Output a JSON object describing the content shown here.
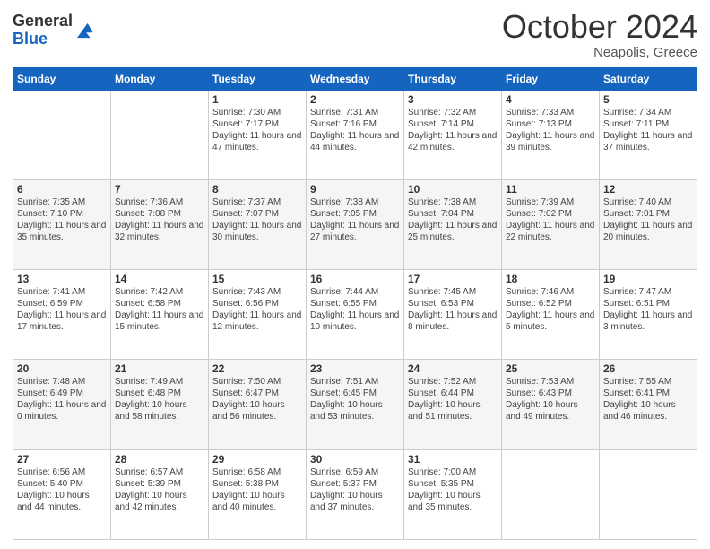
{
  "header": {
    "logo_general": "General",
    "logo_blue": "Blue",
    "month": "October 2024",
    "location": "Neapolis, Greece"
  },
  "weekdays": [
    "Sunday",
    "Monday",
    "Tuesday",
    "Wednesday",
    "Thursday",
    "Friday",
    "Saturday"
  ],
  "weeks": [
    [
      {
        "day": "",
        "sunrise": "",
        "sunset": "",
        "daylight": ""
      },
      {
        "day": "",
        "sunrise": "",
        "sunset": "",
        "daylight": ""
      },
      {
        "day": "1",
        "sunrise": "Sunrise: 7:30 AM",
        "sunset": "Sunset: 7:17 PM",
        "daylight": "Daylight: 11 hours and 47 minutes."
      },
      {
        "day": "2",
        "sunrise": "Sunrise: 7:31 AM",
        "sunset": "Sunset: 7:16 PM",
        "daylight": "Daylight: 11 hours and 44 minutes."
      },
      {
        "day": "3",
        "sunrise": "Sunrise: 7:32 AM",
        "sunset": "Sunset: 7:14 PM",
        "daylight": "Daylight: 11 hours and 42 minutes."
      },
      {
        "day": "4",
        "sunrise": "Sunrise: 7:33 AM",
        "sunset": "Sunset: 7:13 PM",
        "daylight": "Daylight: 11 hours and 39 minutes."
      },
      {
        "day": "5",
        "sunrise": "Sunrise: 7:34 AM",
        "sunset": "Sunset: 7:11 PM",
        "daylight": "Daylight: 11 hours and 37 minutes."
      }
    ],
    [
      {
        "day": "6",
        "sunrise": "Sunrise: 7:35 AM",
        "sunset": "Sunset: 7:10 PM",
        "daylight": "Daylight: 11 hours and 35 minutes."
      },
      {
        "day": "7",
        "sunrise": "Sunrise: 7:36 AM",
        "sunset": "Sunset: 7:08 PM",
        "daylight": "Daylight: 11 hours and 32 minutes."
      },
      {
        "day": "8",
        "sunrise": "Sunrise: 7:37 AM",
        "sunset": "Sunset: 7:07 PM",
        "daylight": "Daylight: 11 hours and 30 minutes."
      },
      {
        "day": "9",
        "sunrise": "Sunrise: 7:38 AM",
        "sunset": "Sunset: 7:05 PM",
        "daylight": "Daylight: 11 hours and 27 minutes."
      },
      {
        "day": "10",
        "sunrise": "Sunrise: 7:38 AM",
        "sunset": "Sunset: 7:04 PM",
        "daylight": "Daylight: 11 hours and 25 minutes."
      },
      {
        "day": "11",
        "sunrise": "Sunrise: 7:39 AM",
        "sunset": "Sunset: 7:02 PM",
        "daylight": "Daylight: 11 hours and 22 minutes."
      },
      {
        "day": "12",
        "sunrise": "Sunrise: 7:40 AM",
        "sunset": "Sunset: 7:01 PM",
        "daylight": "Daylight: 11 hours and 20 minutes."
      }
    ],
    [
      {
        "day": "13",
        "sunrise": "Sunrise: 7:41 AM",
        "sunset": "Sunset: 6:59 PM",
        "daylight": "Daylight: 11 hours and 17 minutes."
      },
      {
        "day": "14",
        "sunrise": "Sunrise: 7:42 AM",
        "sunset": "Sunset: 6:58 PM",
        "daylight": "Daylight: 11 hours and 15 minutes."
      },
      {
        "day": "15",
        "sunrise": "Sunrise: 7:43 AM",
        "sunset": "Sunset: 6:56 PM",
        "daylight": "Daylight: 11 hours and 12 minutes."
      },
      {
        "day": "16",
        "sunrise": "Sunrise: 7:44 AM",
        "sunset": "Sunset: 6:55 PM",
        "daylight": "Daylight: 11 hours and 10 minutes."
      },
      {
        "day": "17",
        "sunrise": "Sunrise: 7:45 AM",
        "sunset": "Sunset: 6:53 PM",
        "daylight": "Daylight: 11 hours and 8 minutes."
      },
      {
        "day": "18",
        "sunrise": "Sunrise: 7:46 AM",
        "sunset": "Sunset: 6:52 PM",
        "daylight": "Daylight: 11 hours and 5 minutes."
      },
      {
        "day": "19",
        "sunrise": "Sunrise: 7:47 AM",
        "sunset": "Sunset: 6:51 PM",
        "daylight": "Daylight: 11 hours and 3 minutes."
      }
    ],
    [
      {
        "day": "20",
        "sunrise": "Sunrise: 7:48 AM",
        "sunset": "Sunset: 6:49 PM",
        "daylight": "Daylight: 11 hours and 0 minutes."
      },
      {
        "day": "21",
        "sunrise": "Sunrise: 7:49 AM",
        "sunset": "Sunset: 6:48 PM",
        "daylight": "Daylight: 10 hours and 58 minutes."
      },
      {
        "day": "22",
        "sunrise": "Sunrise: 7:50 AM",
        "sunset": "Sunset: 6:47 PM",
        "daylight": "Daylight: 10 hours and 56 minutes."
      },
      {
        "day": "23",
        "sunrise": "Sunrise: 7:51 AM",
        "sunset": "Sunset: 6:45 PM",
        "daylight": "Daylight: 10 hours and 53 minutes."
      },
      {
        "day": "24",
        "sunrise": "Sunrise: 7:52 AM",
        "sunset": "Sunset: 6:44 PM",
        "daylight": "Daylight: 10 hours and 51 minutes."
      },
      {
        "day": "25",
        "sunrise": "Sunrise: 7:53 AM",
        "sunset": "Sunset: 6:43 PM",
        "daylight": "Daylight: 10 hours and 49 minutes."
      },
      {
        "day": "26",
        "sunrise": "Sunrise: 7:55 AM",
        "sunset": "Sunset: 6:41 PM",
        "daylight": "Daylight: 10 hours and 46 minutes."
      }
    ],
    [
      {
        "day": "27",
        "sunrise": "Sunrise: 6:56 AM",
        "sunset": "Sunset: 5:40 PM",
        "daylight": "Daylight: 10 hours and 44 minutes."
      },
      {
        "day": "28",
        "sunrise": "Sunrise: 6:57 AM",
        "sunset": "Sunset: 5:39 PM",
        "daylight": "Daylight: 10 hours and 42 minutes."
      },
      {
        "day": "29",
        "sunrise": "Sunrise: 6:58 AM",
        "sunset": "Sunset: 5:38 PM",
        "daylight": "Daylight: 10 hours and 40 minutes."
      },
      {
        "day": "30",
        "sunrise": "Sunrise: 6:59 AM",
        "sunset": "Sunset: 5:37 PM",
        "daylight": "Daylight: 10 hours and 37 minutes."
      },
      {
        "day": "31",
        "sunrise": "Sunrise: 7:00 AM",
        "sunset": "Sunset: 5:35 PM",
        "daylight": "Daylight: 10 hours and 35 minutes."
      },
      {
        "day": "",
        "sunrise": "",
        "sunset": "",
        "daylight": ""
      },
      {
        "day": "",
        "sunrise": "",
        "sunset": "",
        "daylight": ""
      }
    ]
  ]
}
